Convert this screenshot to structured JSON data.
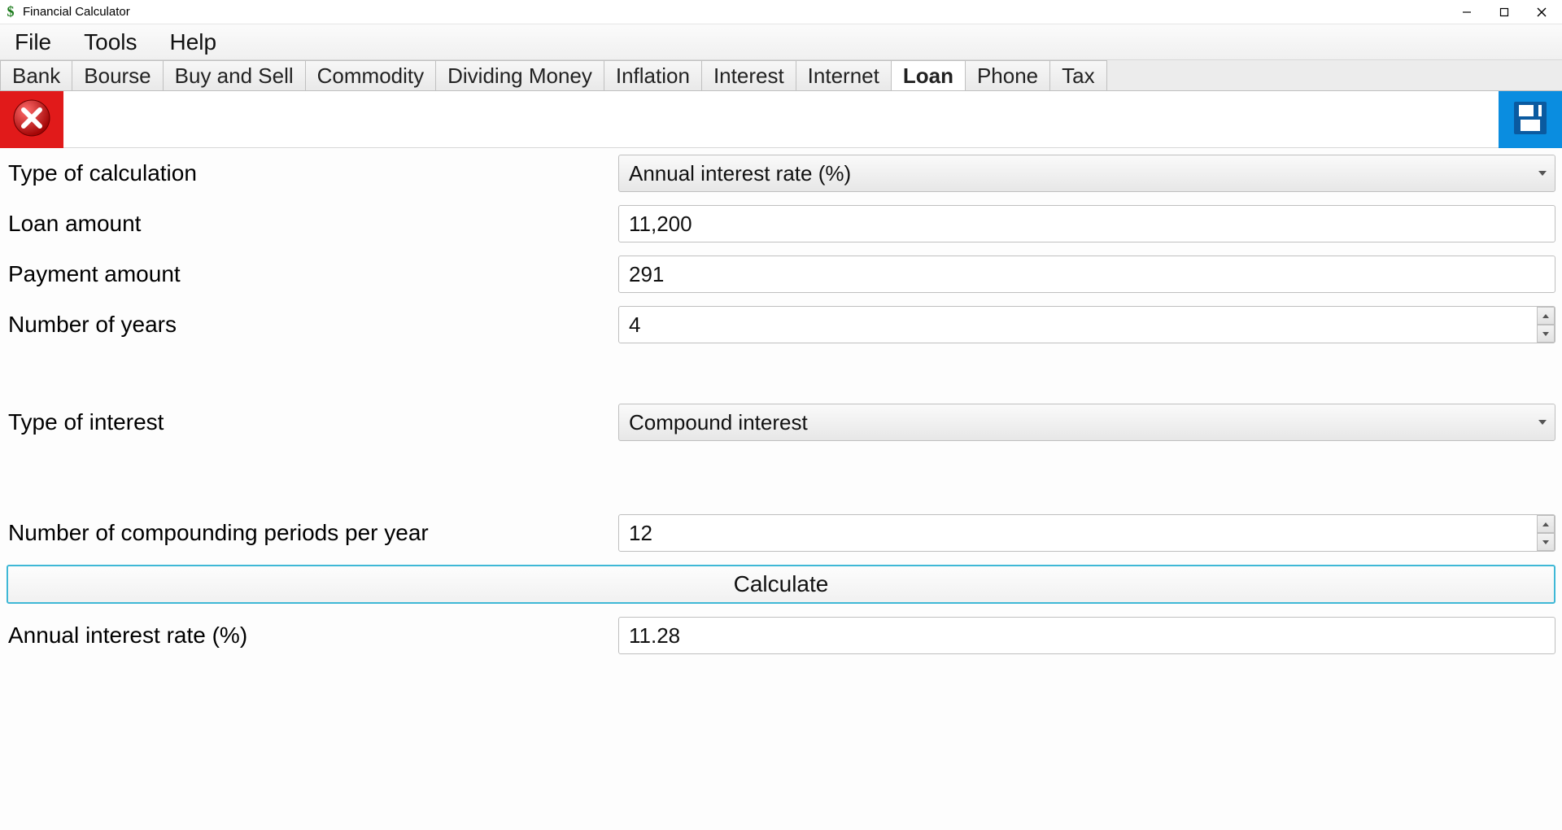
{
  "window": {
    "title": "Financial Calculator"
  },
  "menu": {
    "items": [
      "File",
      "Tools",
      "Help"
    ]
  },
  "tabs": {
    "items": [
      "Bank",
      "Bourse",
      "Buy and Sell",
      "Commodity",
      "Dividing Money",
      "Inflation",
      "Interest",
      "Internet",
      "Loan",
      "Phone",
      "Tax"
    ],
    "active_index": 8
  },
  "form": {
    "type_of_calculation": {
      "label": "Type of calculation",
      "value": "Annual interest rate (%)"
    },
    "loan_amount": {
      "label": "Loan amount",
      "value": "11,200"
    },
    "payment_amount": {
      "label": "Payment amount",
      "value": "291"
    },
    "number_of_years": {
      "label": "Number of years",
      "value": "4"
    },
    "type_of_interest": {
      "label": "Type of interest",
      "value": "Compound interest"
    },
    "compounding_periods": {
      "label": "Number of compounding periods per year",
      "value": "12"
    },
    "calculate_label": "Calculate",
    "result": {
      "label": "Annual interest rate (%)",
      "value": "11.28"
    }
  }
}
